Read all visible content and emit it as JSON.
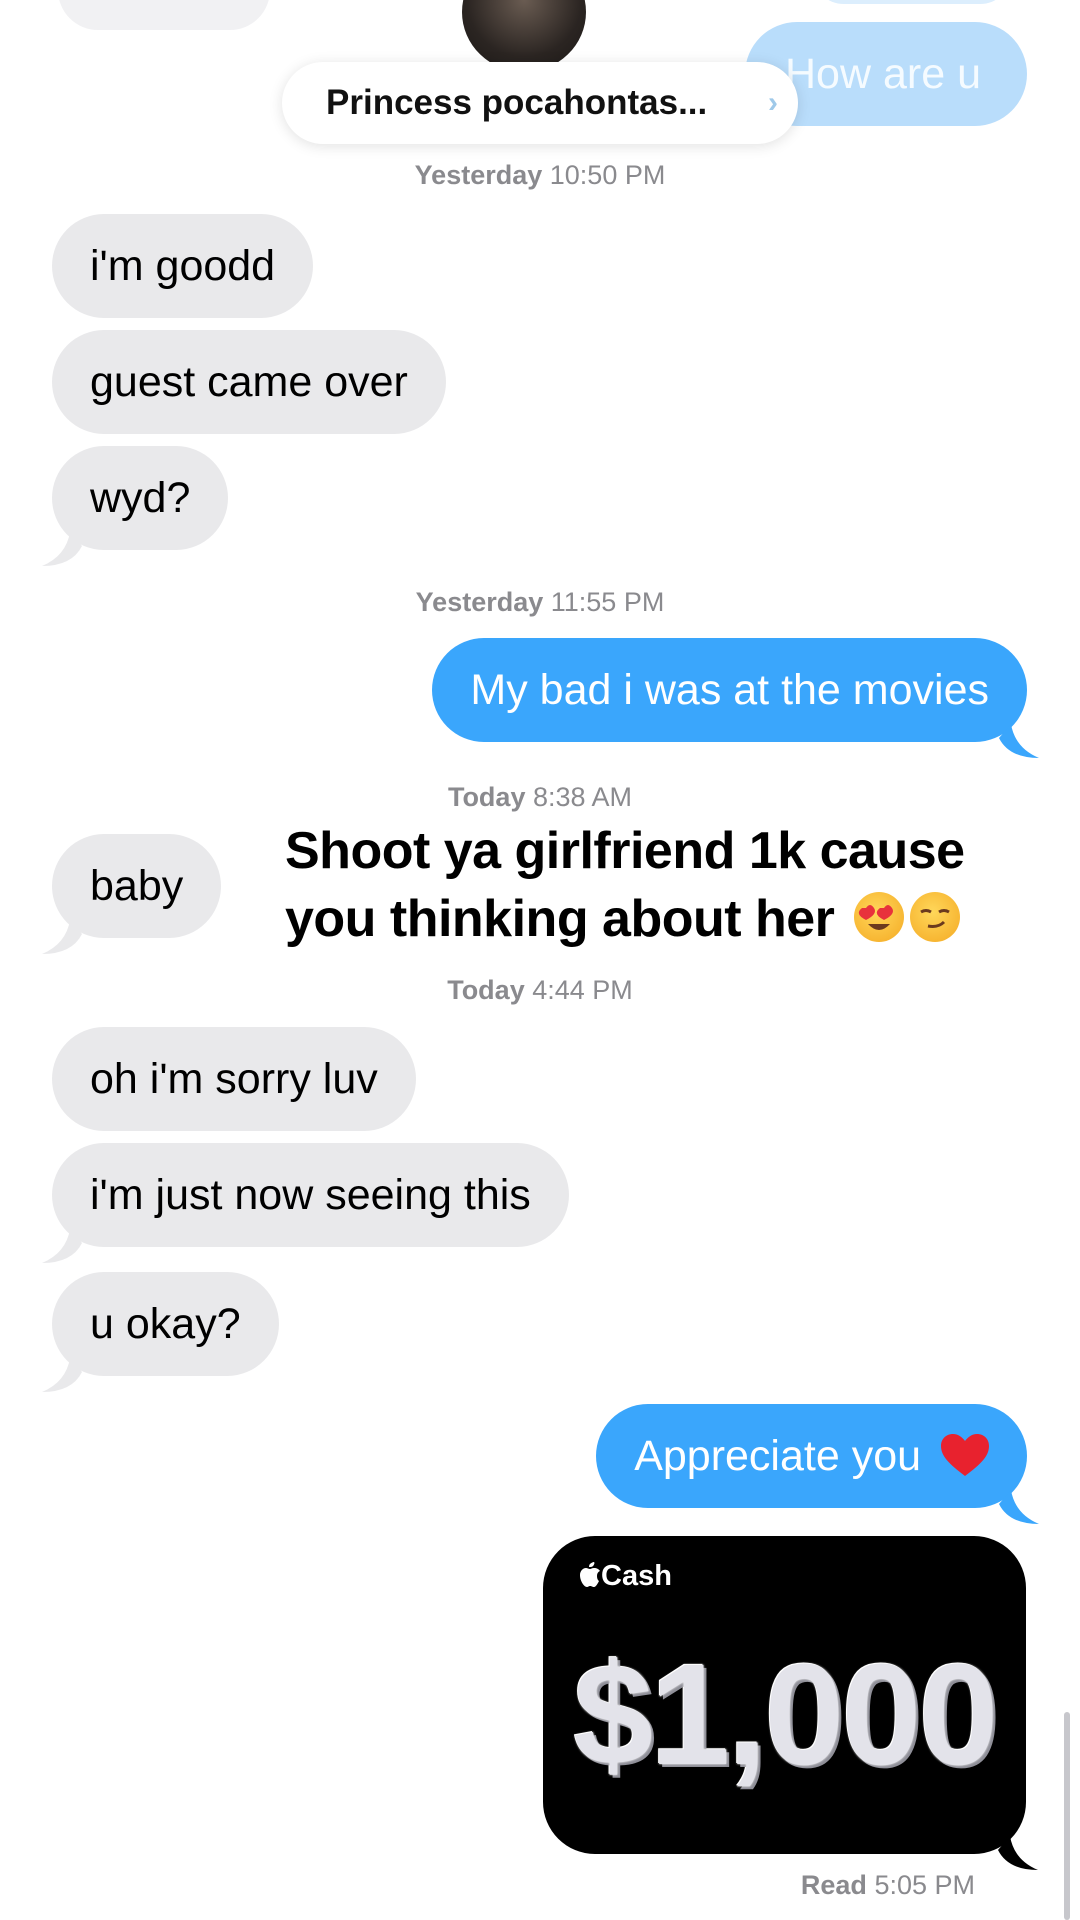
{
  "header": {
    "contact_name": "Princess pocahontas...",
    "chevron": "›",
    "avatar_icon": "contact-photo"
  },
  "top_partial": {
    "outgoing_text": "How are u"
  },
  "timestamps": [
    {
      "day": "Yesterday",
      "time": "10:50 PM"
    },
    {
      "day": "Yesterday",
      "time": "11:55 PM"
    },
    {
      "day": "Today",
      "time": "8:38 AM"
    },
    {
      "day": "Today",
      "time": "4:44 PM"
    }
  ],
  "messages": {
    "m1": "i'm goodd",
    "m2": "guest came over",
    "m3": "wyd?",
    "m4": "My bad i was at the movies",
    "m5": "baby",
    "m6": "oh i'm sorry luv",
    "m7": "i'm just now seeing this",
    "m8": "u okay?",
    "m9": "Appreciate you"
  },
  "overlay": {
    "line1": "Shoot ya girlfriend 1k cause",
    "line2": "you thinking about her"
  },
  "cash": {
    "brand": "Cash",
    "amount": "$1,000"
  },
  "read_receipt": {
    "label": "Read",
    "time": "5:05 PM"
  },
  "colors": {
    "outgoing": "#3aa6fc",
    "incoming": "#e9e9eb",
    "timestamp": "#8a8a8e"
  }
}
